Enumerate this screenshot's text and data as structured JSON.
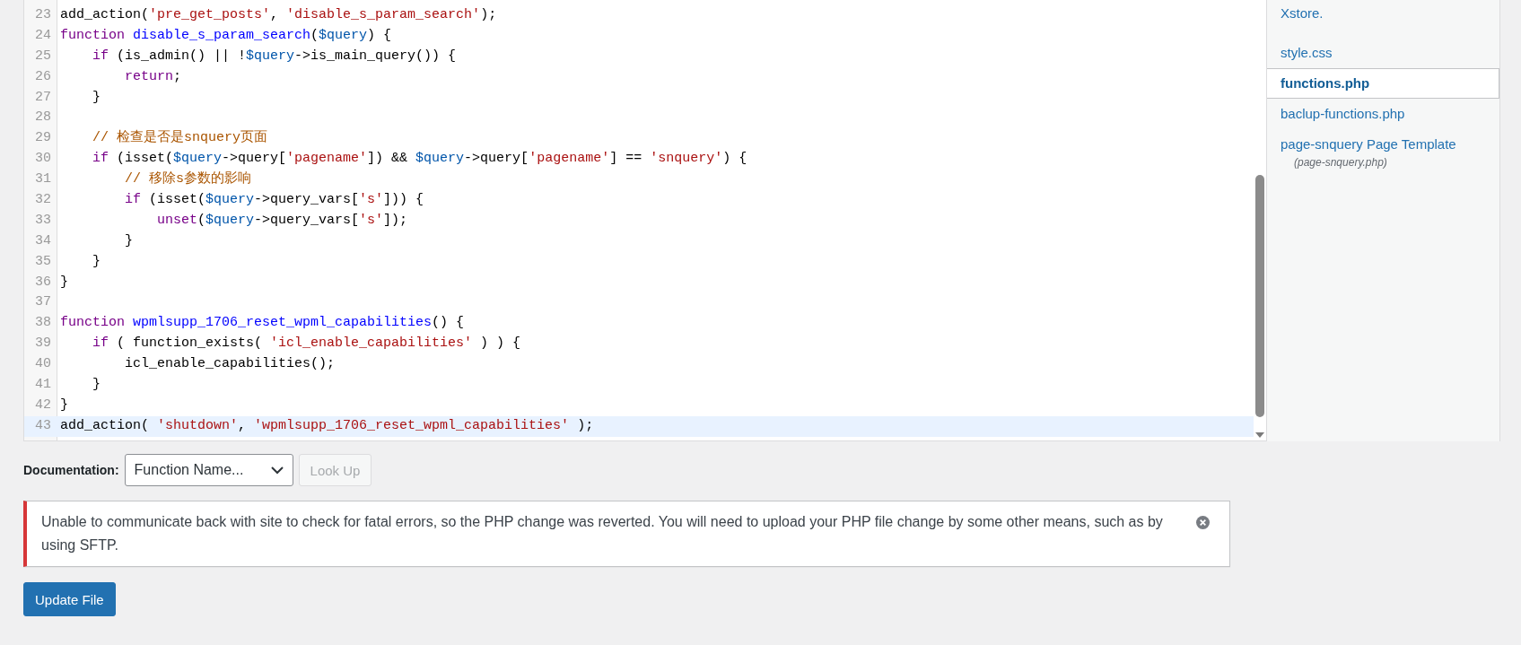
{
  "editor": {
    "lines": [
      {
        "number": "23",
        "active": false,
        "tokens": [
          {
            "kind": "plain",
            "text": "add_action("
          },
          {
            "kind": "string",
            "text": "'pre_get_posts'"
          },
          {
            "kind": "plain",
            "text": ", "
          },
          {
            "kind": "string",
            "text": "'disable_s_param_search'"
          },
          {
            "kind": "plain",
            "text": ");"
          }
        ]
      },
      {
        "number": "24",
        "active": false,
        "tokens": [
          {
            "kind": "keyword",
            "text": "function "
          },
          {
            "kind": "def",
            "text": "disable_s_param_search"
          },
          {
            "kind": "plain",
            "text": "("
          },
          {
            "kind": "variable",
            "text": "$query"
          },
          {
            "kind": "plain",
            "text": ") {"
          }
        ]
      },
      {
        "number": "25",
        "active": false,
        "tokens": [
          {
            "kind": "keyword",
            "text": "    if"
          },
          {
            "kind": "plain",
            "text": " (is_admin() || !"
          },
          {
            "kind": "variable",
            "text": "$query"
          },
          {
            "kind": "plain",
            "text": "->is_main_query()) {"
          }
        ]
      },
      {
        "number": "26",
        "active": false,
        "tokens": [
          {
            "kind": "keyword",
            "text": "        return"
          },
          {
            "kind": "plain",
            "text": ";"
          }
        ]
      },
      {
        "number": "27",
        "active": false,
        "tokens": [
          {
            "kind": "plain",
            "text": "    }"
          }
        ]
      },
      {
        "number": "28",
        "active": false
      },
      {
        "number": "29",
        "active": false,
        "tokens": [
          {
            "kind": "comment",
            "text": "    // 检查是否是snquery页面"
          }
        ]
      },
      {
        "number": "30",
        "active": false,
        "tokens": [
          {
            "kind": "keyword",
            "text": "    if"
          },
          {
            "kind": "plain",
            "text": " (isset("
          },
          {
            "kind": "variable",
            "text": "$query"
          },
          {
            "kind": "plain",
            "text": "->query["
          },
          {
            "kind": "string",
            "text": "'pagename'"
          },
          {
            "kind": "plain",
            "text": "]) && "
          },
          {
            "kind": "variable",
            "text": "$query"
          },
          {
            "kind": "plain",
            "text": "->query["
          },
          {
            "kind": "string",
            "text": "'pagename'"
          },
          {
            "kind": "plain",
            "text": "] == "
          },
          {
            "kind": "string",
            "text": "'snquery'"
          },
          {
            "kind": "plain",
            "text": ") {"
          }
        ]
      },
      {
        "number": "31",
        "active": false,
        "tokens": [
          {
            "kind": "comment",
            "text": "        // 移除s参数的影响"
          }
        ]
      },
      {
        "number": "32",
        "active": false,
        "tokens": [
          {
            "kind": "keyword",
            "text": "        if"
          },
          {
            "kind": "plain",
            "text": " (isset("
          },
          {
            "kind": "variable",
            "text": "$query"
          },
          {
            "kind": "plain",
            "text": "->query_vars["
          },
          {
            "kind": "string",
            "text": "'s'"
          },
          {
            "kind": "plain",
            "text": "])) {"
          }
        ]
      },
      {
        "number": "33",
        "active": false,
        "tokens": [
          {
            "kind": "keyword",
            "text": "            unset"
          },
          {
            "kind": "plain",
            "text": "("
          },
          {
            "kind": "variable",
            "text": "$query"
          },
          {
            "kind": "plain",
            "text": "->query_vars["
          },
          {
            "kind": "string",
            "text": "'s'"
          },
          {
            "kind": "plain",
            "text": "]);"
          }
        ]
      },
      {
        "number": "34",
        "active": false,
        "tokens": [
          {
            "kind": "plain",
            "text": "        }"
          }
        ]
      },
      {
        "number": "35",
        "active": false,
        "tokens": [
          {
            "kind": "plain",
            "text": "    }"
          }
        ]
      },
      {
        "number": "36",
        "active": false,
        "tokens": [
          {
            "kind": "plain",
            "text": "}"
          }
        ]
      },
      {
        "number": "37",
        "active": false
      },
      {
        "number": "38",
        "active": false,
        "tokens": [
          {
            "kind": "keyword",
            "text": "function "
          },
          {
            "kind": "def",
            "text": "wpmlsupp_1706_reset_wpml_capabilities"
          },
          {
            "kind": "plain",
            "text": "() {"
          }
        ]
      },
      {
        "number": "39",
        "active": false,
        "tokens": [
          {
            "kind": "keyword",
            "text": "    if"
          },
          {
            "kind": "plain",
            "text": " ( function_exists( "
          },
          {
            "kind": "string",
            "text": "'icl_enable_capabilities'"
          },
          {
            "kind": "plain",
            "text": " ) ) {"
          }
        ]
      },
      {
        "number": "40",
        "active": false,
        "tokens": [
          {
            "kind": "plain",
            "text": "        icl_enable_capabilities();"
          }
        ]
      },
      {
        "number": "41",
        "active": false,
        "tokens": [
          {
            "kind": "plain",
            "text": "    }"
          }
        ]
      },
      {
        "number": "42",
        "active": false,
        "tokens": [
          {
            "kind": "plain",
            "text": "}"
          }
        ]
      },
      {
        "number": "43",
        "active": true,
        "tokens": [
          {
            "kind": "plain",
            "text": "add_action( "
          },
          {
            "kind": "string",
            "text": "'shutdown'"
          },
          {
            "kind": "plain",
            "text": ", "
          },
          {
            "kind": "string",
            "text": "'wpmlsupp_1706_reset_wpml_capabilities'"
          },
          {
            "kind": "plain",
            "text": " );"
          }
        ]
      }
    ]
  },
  "sidebar": {
    "description": "Xstore.",
    "files": [
      {
        "label": "style.css",
        "selected": false
      },
      {
        "label": "functions.php",
        "selected": true
      },
      {
        "label": "baclup-functions.php",
        "selected": false
      },
      {
        "label": "page-snquery Page Template",
        "sub": "(page-snquery.php)",
        "selected": false
      }
    ]
  },
  "documentation": {
    "label": "Documentation:",
    "select": {
      "value": "Function Name..."
    },
    "lookup_button": {
      "label": "Look Up",
      "disabled": true
    }
  },
  "notice": {
    "kind": "error",
    "message": "Unable to communicate back with site to check for fatal errors, so the PHP change was reverted. You will need to upload your PHP file change by some other means, such as by using SFTP."
  },
  "update_button": {
    "label": "Update File"
  }
}
